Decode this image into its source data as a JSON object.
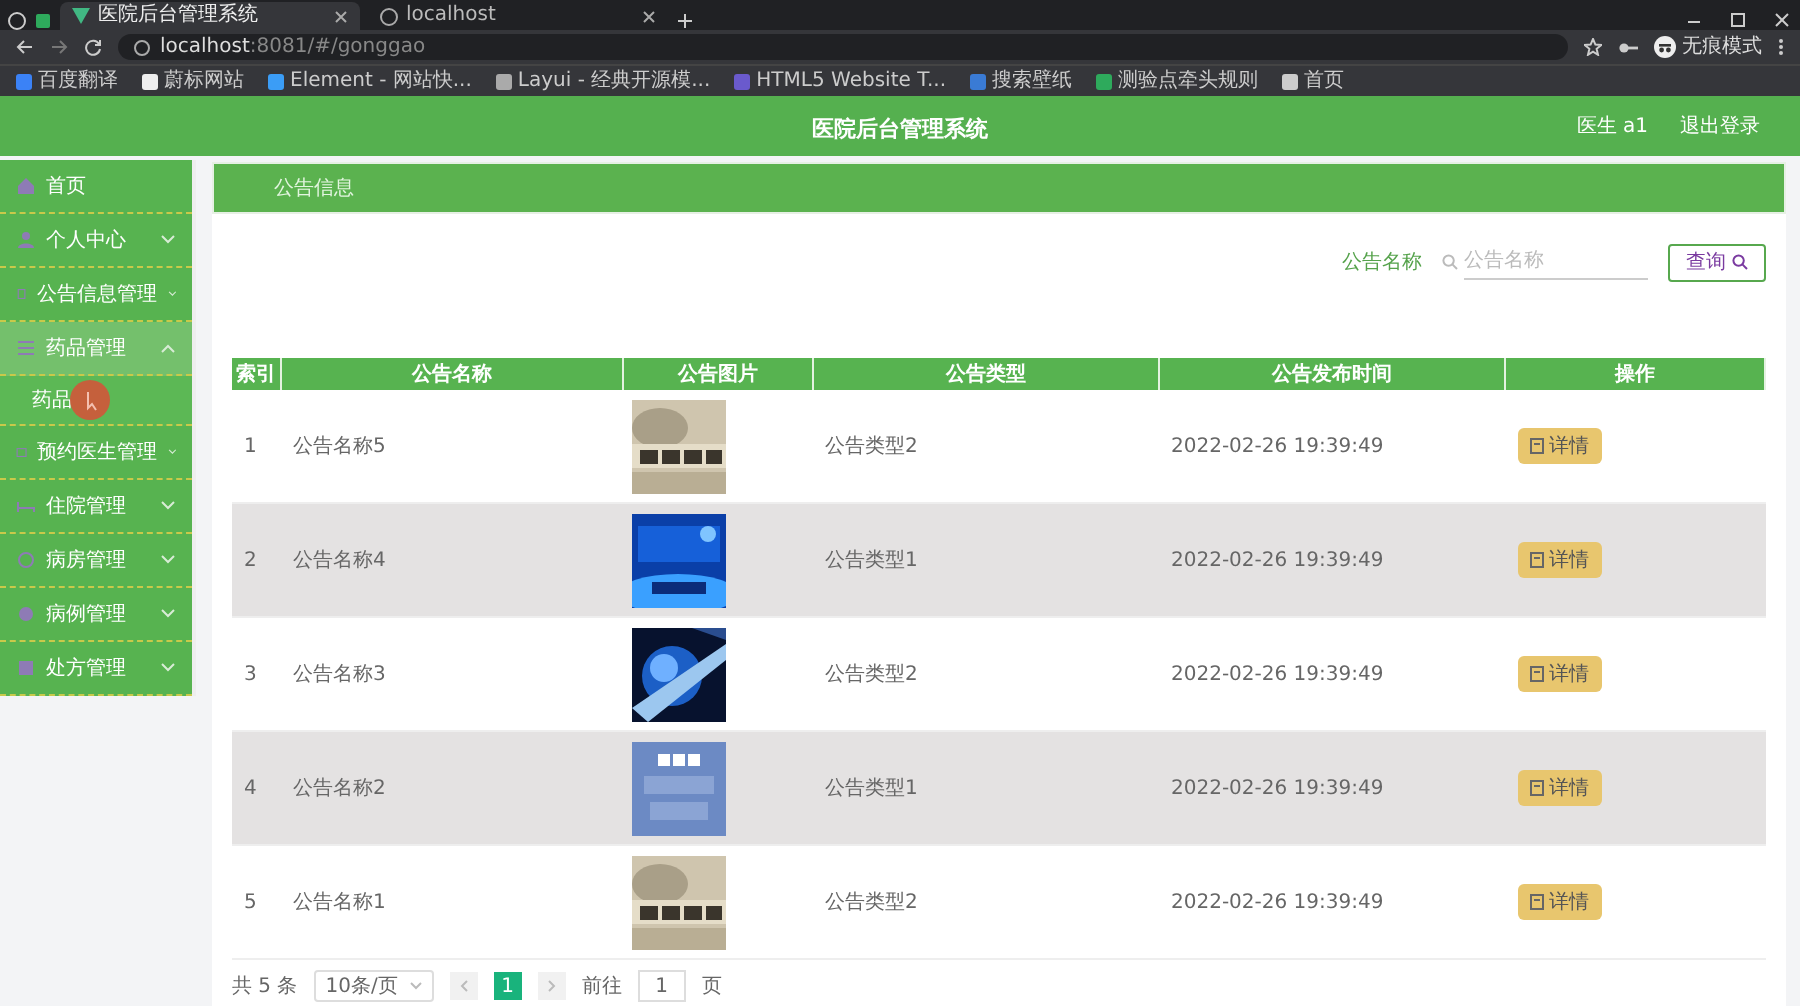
{
  "browser": {
    "tabs": [
      {
        "title": "医院后台管理系统",
        "selected": true
      },
      {
        "title": "localhost",
        "selected": false
      }
    ],
    "url_host": "localhost",
    "url_path": ":8081/#/gonggao",
    "profile": "无痕模式",
    "bookmarks": [
      "百度翻译",
      "蔚标网站",
      "Element - 网站快...",
      "Layui - 经典开源模...",
      "HTML5 Website T...",
      "搜索壁纸",
      "测验点牵头规则",
      "首页"
    ]
  },
  "header": {
    "title": "医院后台管理系统",
    "user": "医生 a1",
    "logout": "退出登录"
  },
  "sidebar": {
    "items": [
      {
        "label": "首页",
        "kind": "link"
      },
      {
        "label": "个人中心",
        "kind": "menu",
        "expanded": false
      },
      {
        "label": "公告信息管理",
        "kind": "menu",
        "expanded": false
      },
      {
        "label": "药品管理",
        "kind": "menu",
        "expanded": true,
        "children": [
          {
            "label": "药品"
          }
        ]
      },
      {
        "label": "预约医生管理",
        "kind": "menu",
        "expanded": false
      },
      {
        "label": "住院管理",
        "kind": "menu",
        "expanded": false
      },
      {
        "label": "病房管理",
        "kind": "menu",
        "expanded": false
      },
      {
        "label": "病例管理",
        "kind": "menu",
        "expanded": false
      },
      {
        "label": "处方管理",
        "kind": "menu",
        "expanded": false
      }
    ]
  },
  "breadcrumb": "公告信息",
  "search": {
    "label": "公告名称",
    "placeholder": "公告名称",
    "button": "查询"
  },
  "table": {
    "columns": [
      "索引",
      "公告名称",
      "公告图片",
      "公告类型",
      "公告发布时间",
      "操作"
    ],
    "rows": [
      {
        "index": "1",
        "name": "公告名称5",
        "type": "公告类型2",
        "time": "2022-02-26 19:39:49",
        "action": "详情"
      },
      {
        "index": "2",
        "name": "公告名称4",
        "type": "公告类型1",
        "time": "2022-02-26 19:39:49",
        "action": "详情"
      },
      {
        "index": "3",
        "name": "公告名称3",
        "type": "公告类型2",
        "time": "2022-02-26 19:39:49",
        "action": "详情"
      },
      {
        "index": "4",
        "name": "公告名称2",
        "type": "公告类型1",
        "time": "2022-02-26 19:39:49",
        "action": "详情"
      },
      {
        "index": "5",
        "name": "公告名称1",
        "type": "公告类型2",
        "time": "2022-02-26 19:39:49",
        "action": "详情"
      }
    ]
  },
  "pagination": {
    "total": "共 5 条",
    "page_size": "10条/页",
    "pages": [
      {
        "label": "1",
        "selected": true
      }
    ],
    "goto_label": "前往",
    "goto_value": "1",
    "page_suffix": "页"
  }
}
